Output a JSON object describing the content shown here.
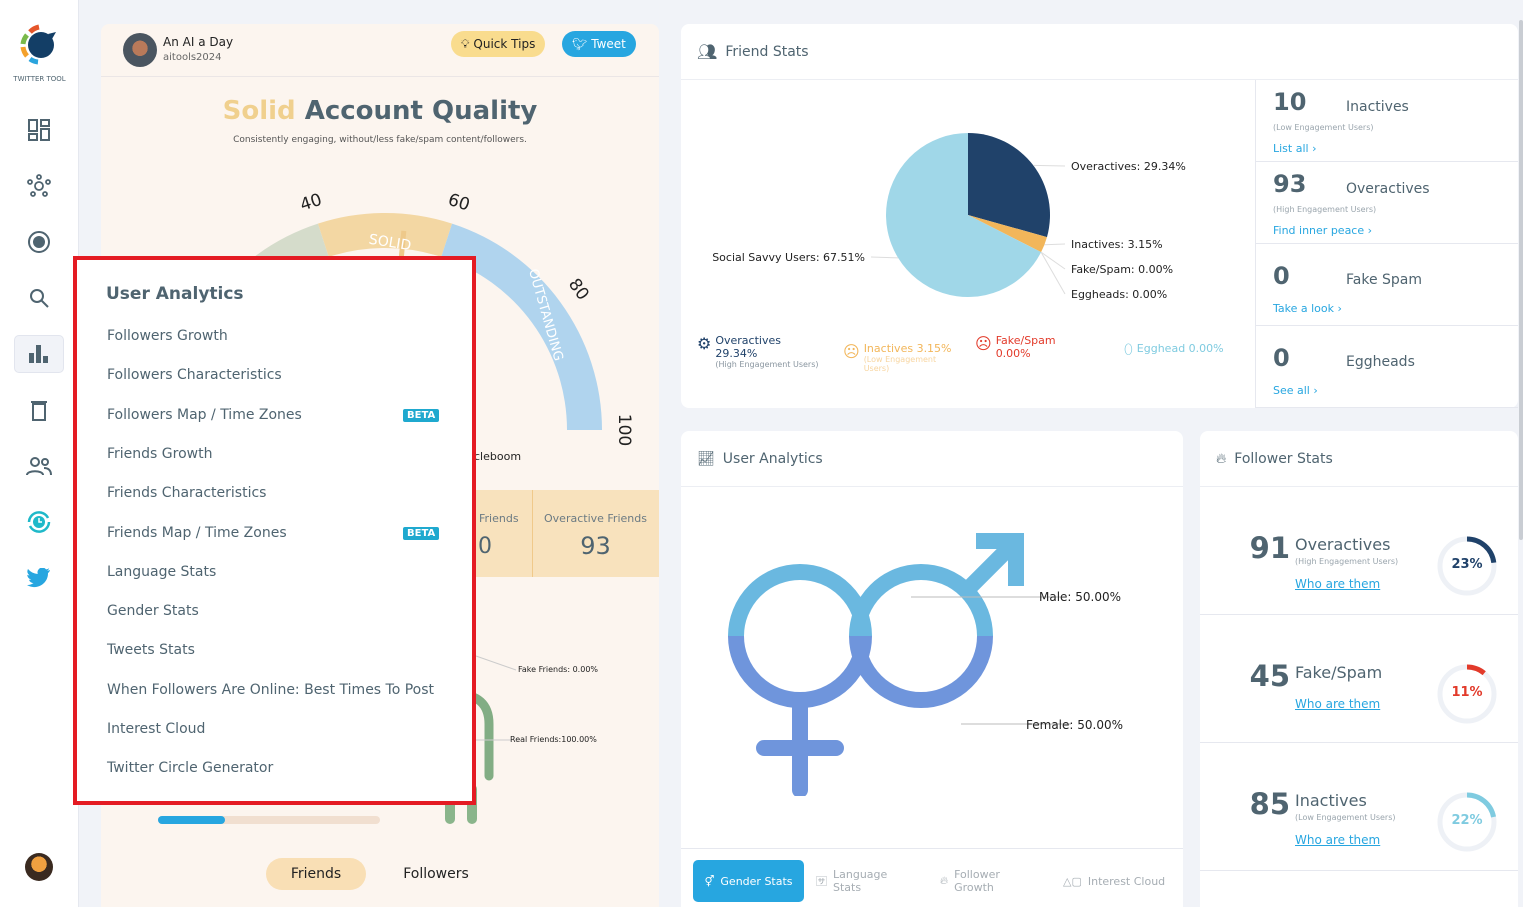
{
  "sidebar": {
    "logo_text": "TWITTER TOOL",
    "icons": [
      "dashboard-icon",
      "network-icon",
      "target-icon",
      "search-icon",
      "bar-chart-icon",
      "trash-icon",
      "users-icon",
      "history-icon",
      "twitter-icon"
    ],
    "active": "bar-chart-icon"
  },
  "profile": {
    "name": "An AI a Day",
    "handle": "aitools2024"
  },
  "header_buttons": {
    "quick_tips": "Quick Tips",
    "tweet": "Tweet"
  },
  "quality": {
    "level": "Solid",
    "title_rest": "Account Quality",
    "description": "Consistently engaging, without/less fake/spam content/followers.",
    "gauge_value": 53,
    "gauge_ticks": [
      "40",
      "60",
      "80",
      "100"
    ],
    "segment_labels": [
      "SOLID",
      "OUTSTANDING"
    ]
  },
  "left_extra": {
    "partial_text": "cleboom",
    "stats": [
      {
        "label": "Friends",
        "value": "0"
      },
      {
        "label": "Overactive Friends",
        "value": "93"
      }
    ],
    "fake_friends": "Fake Friends: 0.00%",
    "real_friends": "Real Friends:100.00%",
    "progress": 0.3,
    "tabs": [
      "Friends",
      "Followers"
    ],
    "active_tab": "Friends"
  },
  "menu": {
    "title": "User Analytics",
    "items": [
      {
        "label": "Followers Growth"
      },
      {
        "label": "Followers Characteristics"
      },
      {
        "label": "Followers Map / Time Zones",
        "badge": "BETA"
      },
      {
        "label": "Friends Growth"
      },
      {
        "label": "Friends Characteristics"
      },
      {
        "label": "Friends Map / Time Zones",
        "badge": "BETA"
      },
      {
        "label": "Language Stats"
      },
      {
        "label": "Gender Stats"
      },
      {
        "label": "Tweets Stats"
      },
      {
        "label": "When Followers Are Online: Best Times To Post"
      },
      {
        "label": "Interest Cloud"
      },
      {
        "label": "Twitter Circle Generator"
      }
    ]
  },
  "friend_stats": {
    "title": "Friend Stats",
    "chart_data": {
      "type": "pie",
      "slices": [
        {
          "label": "Overactives",
          "value": 29.34,
          "color": "#20426a",
          "text": "Overactives: 29.34%"
        },
        {
          "label": "Inactives",
          "value": 3.15,
          "color": "#f2b65a",
          "text": "Inactives: 3.15%"
        },
        {
          "label": "Fake/Spam",
          "value": 0,
          "color": "#e23a2a",
          "text": "Fake/Spam: 0.00%"
        },
        {
          "label": "Eggheads",
          "value": 0,
          "color": "#7fcbe0",
          "text": "Eggheads: 0.00%"
        },
        {
          "label": "Social Savvy Users",
          "value": 67.51,
          "color": "#a0d7e8",
          "text": "Social Savvy Users: 67.51%"
        }
      ]
    },
    "legend": [
      {
        "title": "Overactives",
        "value": "29.34%",
        "sub": "(High Engagement Users)",
        "color": "#20426a"
      },
      {
        "title": "Inactives 3.15%",
        "sub": "(Low Engagement Users)",
        "color": "#f2b65a"
      },
      {
        "title": "Fake/Spam",
        "value": "0.00%",
        "color": "#e23a2a"
      },
      {
        "title": "Egghead 0.00%",
        "color": "#7fcbe0"
      }
    ],
    "side": [
      {
        "count": "10",
        "label": "Inactives",
        "sub": "(Low Engagement Users)",
        "link": "List all"
      },
      {
        "count": "93",
        "label": "Overactives",
        "sub": "(High Engagement Users)",
        "link": "Find inner peace"
      },
      {
        "count": "0",
        "label": "Fake Spam",
        "link": "Take a look"
      },
      {
        "count": "0",
        "label": "Eggheads",
        "link": "See all"
      }
    ]
  },
  "user_analytics": {
    "title": "User Analytics",
    "male": "Male: 50.00%",
    "female": "Female: 50.00%",
    "tabs": [
      "Gender Stats",
      "Language Stats",
      "Follower Growth",
      "Interest Cloud"
    ],
    "active_tab": "Gender Stats"
  },
  "follower_stats": {
    "title": "Follower Stats",
    "rows": [
      {
        "count": "91",
        "label": "Overactives",
        "sub": "(High Engagement Users)",
        "link": "Who are them",
        "percent": 23,
        "percent_text": "23%",
        "color": "#20426a"
      },
      {
        "count": "45",
        "label": "Fake/Spam",
        "link": "Who are them",
        "percent": 11,
        "percent_text": "11%",
        "color": "#e23a2a"
      },
      {
        "count": "85",
        "label": "Inactives",
        "sub": "(Low Engagement Users)",
        "link": "Who are them",
        "percent": 22,
        "percent_text": "22%",
        "color": "#7fcbe0"
      }
    ]
  }
}
